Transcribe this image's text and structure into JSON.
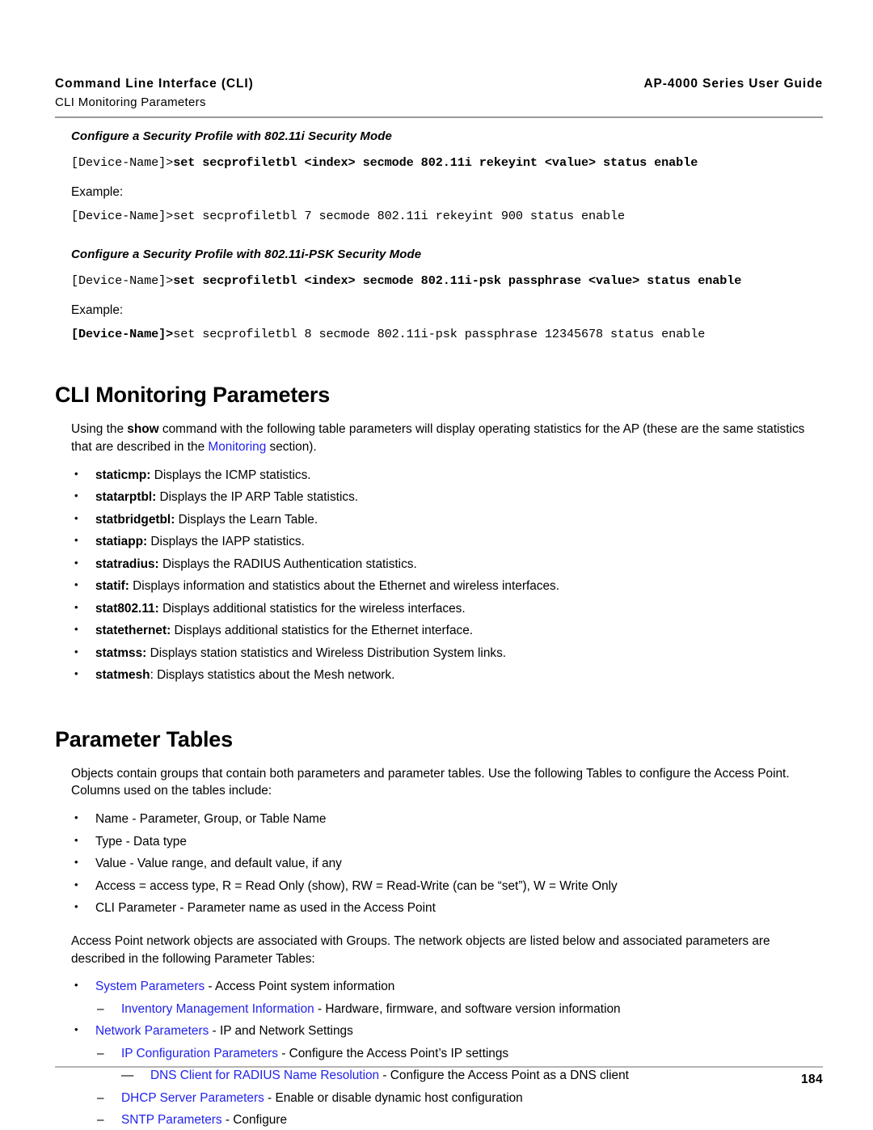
{
  "header": {
    "left_title": "Command Line Interface (CLI)",
    "left_subtitle": "CLI Monitoring Parameters",
    "right_title": "AP-4000 Series User Guide"
  },
  "colors": {
    "link": "#2222ee",
    "rule": "#9a9a9a",
    "text": "#000000"
  },
  "sections": {
    "sec11i": {
      "heading": "Configure a Security Profile with 802.11i Security Mode",
      "command_prefix": "[Device-Name]>",
      "command_body": "set secprofiletbl <index> secmode 802.11i rekeyint <value> status enable",
      "example_label": "Example:",
      "example_prefix": "[Device-Name]>",
      "example_body": "set secprofiletbl 7 secmode 802.11i rekeyint 900 status enable"
    },
    "sec11ipsk": {
      "heading": "Configure a Security Profile with 802.11i-PSK Security Mode",
      "command_prefix": "[Device-Name]>",
      "command_body": "set secprofiletbl <index> secmode 802.11i-psk passphrase <value> status enable",
      "example_label": "Example:",
      "example_prefix": "[Device-Name]>",
      "example_body": "set secprofiletbl 8 secmode 802.11i-psk passphrase 12345678 status enable"
    },
    "cli_monitoring": {
      "title": "CLI Monitoring Parameters",
      "intro_a": "Using the ",
      "intro_show": "show",
      "intro_b": " command with the following table parameters will display operating statistics for the AP (these are the same statistics that are described in the ",
      "intro_link": "Monitoring",
      "intro_c": " section).",
      "items": [
        {
          "term": "staticmp:",
          "desc": " Displays the ICMP statistics."
        },
        {
          "term": "statarptbl:",
          "desc": " Displays the IP ARP Table statistics."
        },
        {
          "term": "statbridgetbl:",
          "desc": " Displays the Learn Table."
        },
        {
          "term": "statiapp:",
          "desc": " Displays the IAPP statistics."
        },
        {
          "term": "statradius:",
          "desc": " Displays the RADIUS Authentication statistics."
        },
        {
          "term": "statif:",
          "desc": " Displays information and statistics about the Ethernet and wireless interfaces."
        },
        {
          "term": "stat802.11:",
          "desc": " Displays additional statistics for the wireless interfaces."
        },
        {
          "term": "statethernet:",
          "desc": " Displays additional statistics for the Ethernet interface."
        },
        {
          "term": "statmss:",
          "desc": " Displays station statistics and Wireless Distribution System links."
        },
        {
          "term": "statmesh",
          "desc": ": Displays statistics about the Mesh network."
        }
      ]
    },
    "parameter_tables": {
      "title": "Parameter Tables",
      "intro": "Objects contain groups that contain both parameters and parameter tables. Use the following Tables to configure the Access Point. Columns used on the tables include:",
      "columns": [
        "Name - Parameter, Group, or Table Name",
        "Type - Data type",
        "Value - Value range, and default value, if any",
        "Access = access type, R = Read Only (show), RW = Read-Write (can be “set”), W = Write Only",
        "CLI Parameter - Parameter name as used in the Access Point"
      ],
      "objects_intro": "Access Point network objects are associated with Groups. The network objects are listed below and associated parameters are described in the following Parameter Tables:",
      "links": {
        "system_parameters": {
          "link": "System Parameters",
          "desc": " - Access Point system information"
        },
        "inventory": {
          "link": "Inventory Management Information",
          "desc": " - Hardware, firmware, and software version information"
        },
        "network_parameters": {
          "link": "Network Parameters",
          "desc": " - IP and Network Settings"
        },
        "ip_config": {
          "link": "IP Configuration Parameters",
          "desc": " - Configure the Access Point’s IP settings"
        },
        "dns_client": {
          "link": "DNS Client for RADIUS Name Resolution",
          "desc": " - Configure the Access Point as a DNS client"
        },
        "dhcp_server": {
          "link": "DHCP Server Parameters",
          "desc": " - Enable or disable dynamic host configuration"
        },
        "sntp": {
          "link": "SNTP Parameters",
          "desc": " - Configure"
        }
      }
    }
  },
  "footer": {
    "page_number": "184"
  }
}
